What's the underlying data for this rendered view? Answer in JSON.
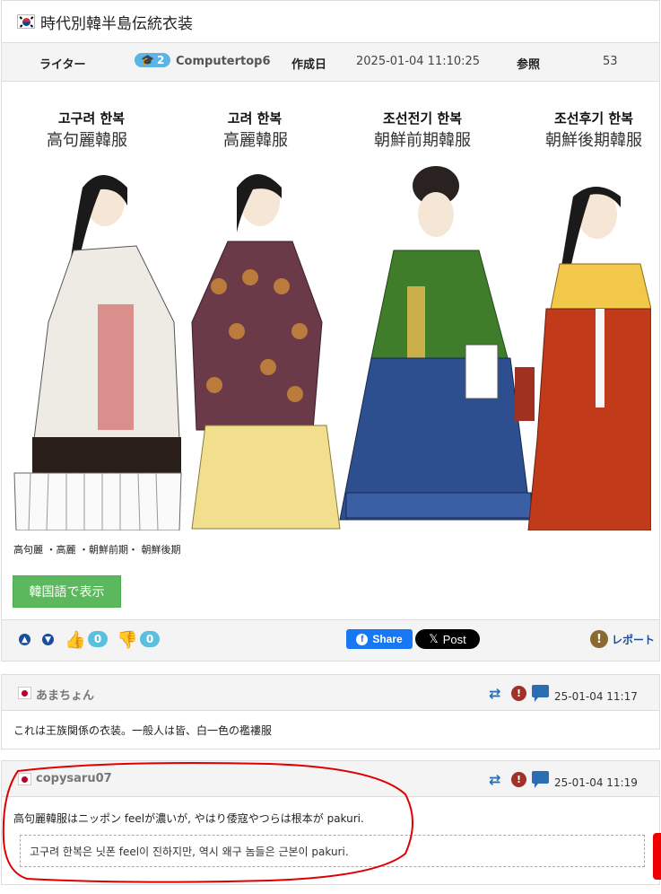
{
  "post": {
    "title": "時代別韓半島伝統衣装",
    "meta": {
      "writer_label": "ライター",
      "level": "2",
      "author": "Computertop6",
      "created_label": "作成日",
      "created_value": "2025-01-04 11:10:25",
      "views_label": "参照",
      "views_value": "53"
    },
    "figure": {
      "panels": [
        {
          "hangul": "고구려 한복",
          "hanja": "高句麗韓服"
        },
        {
          "hangul": "고려 한복",
          "hanja": "高麗韓服"
        },
        {
          "hangul": "조선전기 한복",
          "hanja": "朝鮮前期韓服"
        },
        {
          "hangul": "조선후기 한복",
          "hanja": "朝鮮後期韓服"
        }
      ]
    },
    "caption": "高句麗 ・高麗 ・朝鮮前期・ 朝鮮後期",
    "translate_button": "韓国語で表示",
    "actions": {
      "up_count": "0",
      "down_count": "0",
      "share_label": "Share",
      "post_label": "Post",
      "report_label": "レポート"
    }
  },
  "comments": [
    {
      "author": "あまちょん",
      "time": "25-01-04 11:17",
      "body": "これは王族関係の衣装。一般人は皆、白一色の襤褸服"
    },
    {
      "author": "copysaru07",
      "time": "25-01-04 11:19",
      "body": "高句麗韓服はニッポン feelが濃いが, やはり倭寇やつらは根本が pakuri.",
      "translation": "고구려 한복은 닛폰 feel이 진하지만, 역시 왜구 놈들은 근본이 pakuri."
    }
  ],
  "colors": {
    "accent_blue": "#1a4e9b",
    "vote_badge": "#5bc0de",
    "translate_green": "#5cb85c",
    "annotation_red": "#e00000"
  }
}
